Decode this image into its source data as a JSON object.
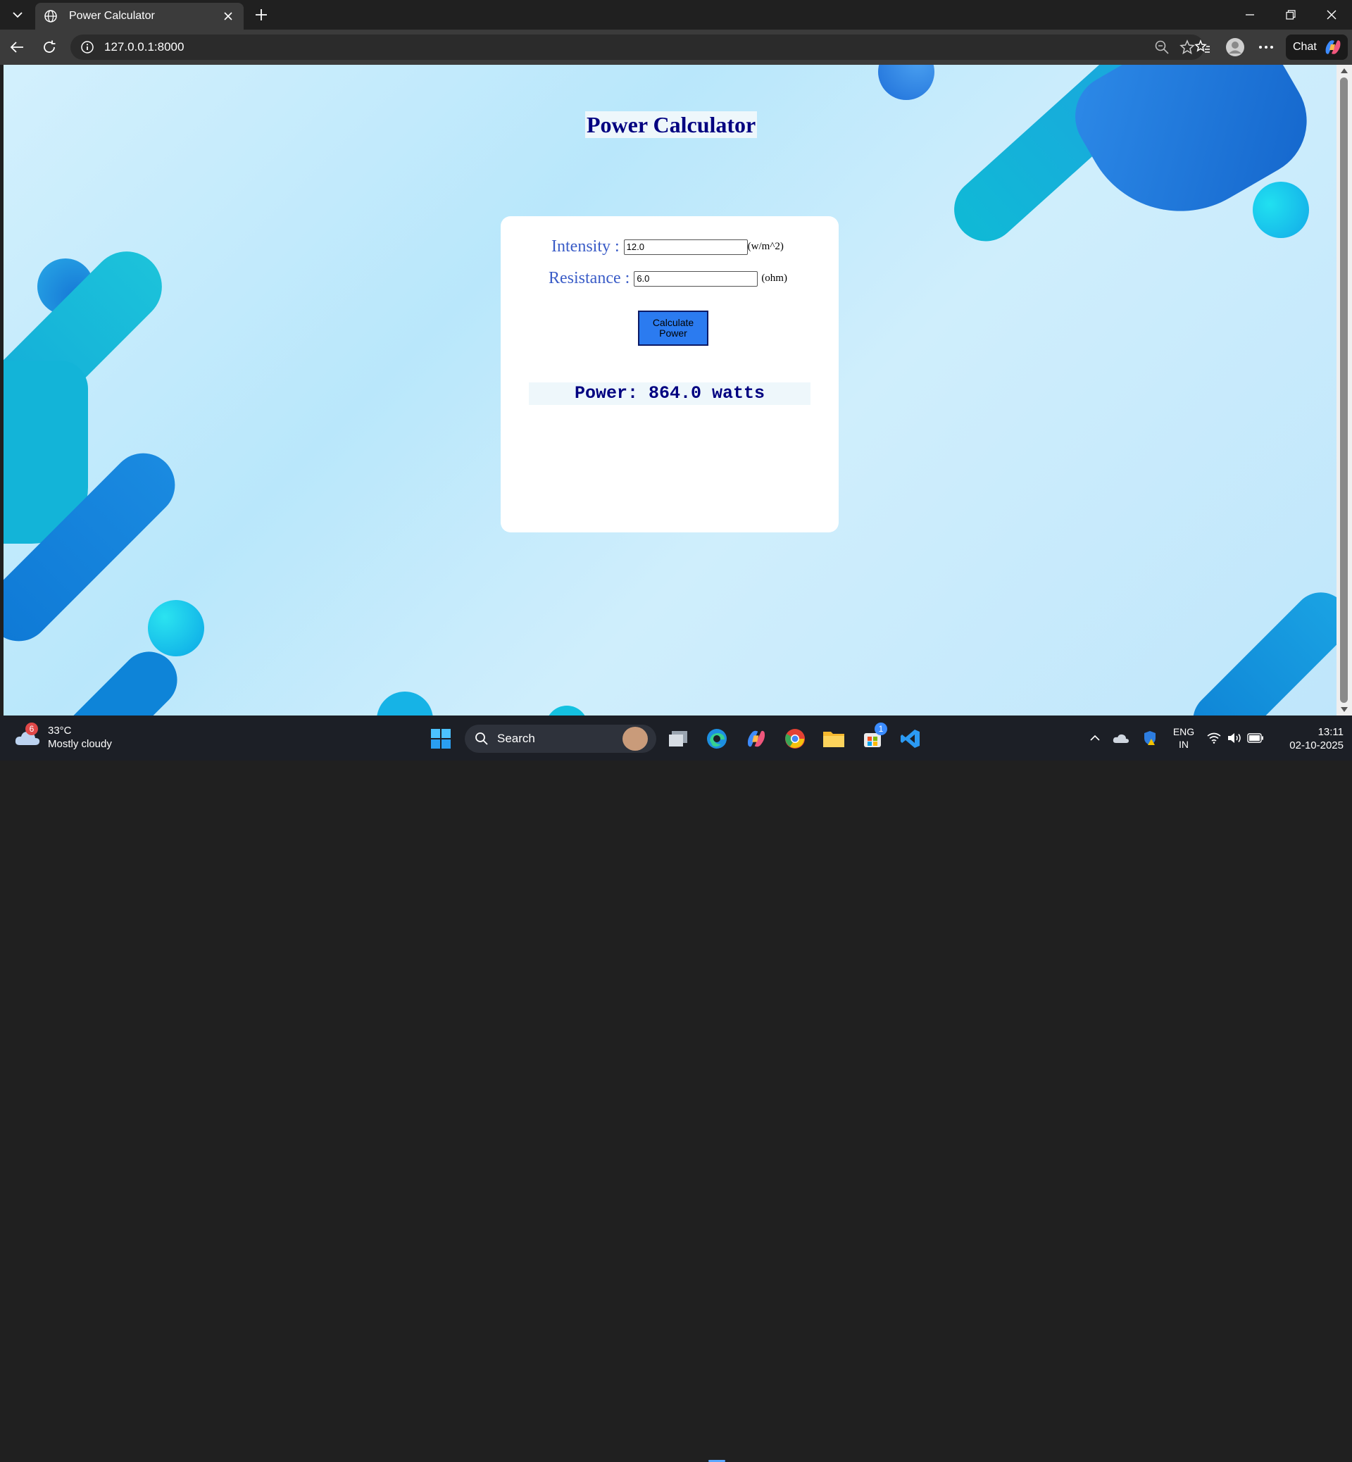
{
  "browser": {
    "tab_title": "Power Calculator",
    "url": "127.0.0.1:8000",
    "chat_label": "Chat"
  },
  "page": {
    "heading": "Power Calculator",
    "intensity_label": "Intensity :",
    "intensity_value": "12.0",
    "intensity_unit": "(w/m^2)",
    "resistance_label": "Resistance :",
    "resistance_value": "6.0",
    "resistance_unit": "(ohm)",
    "button_label": "Calculate Power",
    "result": "Power: 864.0 watts"
  },
  "colors": {
    "heading": "#000080",
    "label": "#3a5cc7",
    "button": "#2b7bf0"
  },
  "taskbar": {
    "weather_badge": "6",
    "temperature": "33°C",
    "condition": "Mostly cloudy",
    "search_label": "Search",
    "store_badge": "1",
    "lang_line1": "ENG",
    "lang_line2": "IN",
    "time": "13:11",
    "date": "02-10-2025"
  }
}
